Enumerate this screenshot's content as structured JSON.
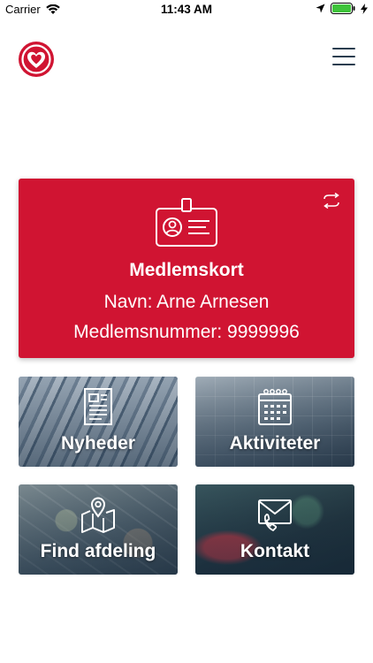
{
  "status_bar": {
    "carrier": "Carrier",
    "time": "11:43 AM"
  },
  "nav": {
    "logo_icon": "heart-logo-icon",
    "menu_icon": "hamburger-menu-icon"
  },
  "member_card": {
    "title": "Medlemskort",
    "name_line": "Navn: Arne Arnesen",
    "number_line": "Medlemsnummer: 9999996",
    "icon": "id-badge-icon",
    "swap_icon": "swap-arrows-icon",
    "color": "#d01432"
  },
  "tiles": [
    {
      "label": "Nyheder",
      "icon": "newspaper-icon"
    },
    {
      "label": "Aktiviteter",
      "icon": "calendar-icon"
    },
    {
      "label": "Find afdeling",
      "icon": "map-pin-icon"
    },
    {
      "label": "Kontakt",
      "icon": "envelope-phone-icon"
    }
  ],
  "colors": {
    "accent": "#d01432",
    "menu": "#2a3d4f"
  }
}
